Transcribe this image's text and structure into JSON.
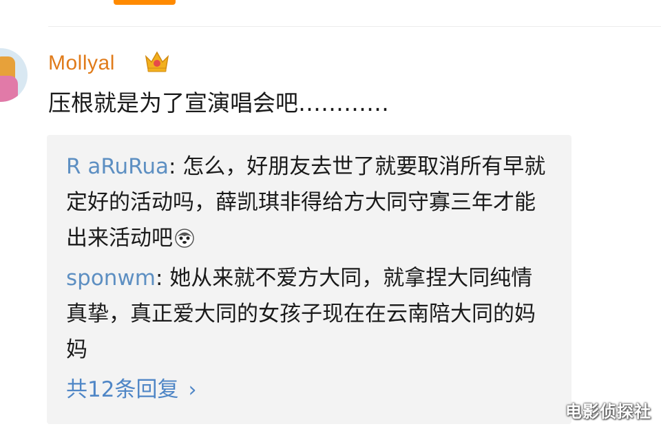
{
  "comment": {
    "username": "Mollyal",
    "text": "压根就是为了宣演唱会吧…………"
  },
  "replies": [
    {
      "author": "R  aRuRua",
      "text": ": 怎么，好朋友去世了就要取消所有早就定好的活动吗，薛凯琪非得给方大同守寡三年才能出来活动吧",
      "emoji": "husky-emoji"
    },
    {
      "author": "    sponwm",
      "text": ": 她从来就不爱方大同，就拿捏大同纯情真挚，真正爱大同的女孩子现在在云南陪大同的妈妈"
    }
  ],
  "more_replies_label": "共12条回复",
  "watermark": "电影侦探社",
  "colors": {
    "accent_tab": "#ff8a00",
    "username": "#e07b1a",
    "reply_author": "#5d8fc2",
    "link": "#4f86c6",
    "reply_bg": "#f3f3f3"
  }
}
